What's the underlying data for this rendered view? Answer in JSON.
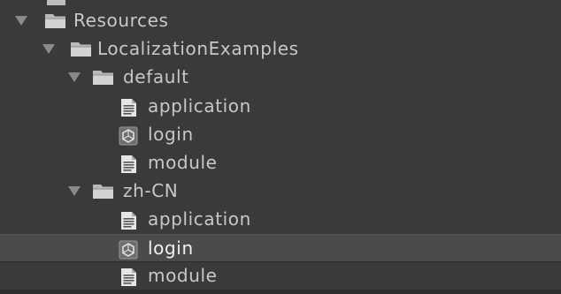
{
  "tree": {
    "items": [
      {
        "label": "Resources",
        "depth": 0,
        "type": "folder",
        "expanded": true,
        "icon": "folder-icon"
      },
      {
        "label": "LocalizationExamples",
        "depth": 1,
        "type": "folder",
        "expanded": true,
        "icon": "folder-icon"
      },
      {
        "label": "default",
        "depth": 2,
        "type": "folder",
        "expanded": true,
        "icon": "folder-icon"
      },
      {
        "label": "application",
        "depth": 3,
        "type": "file",
        "icon": "text-file-icon"
      },
      {
        "label": "login",
        "depth": 3,
        "type": "asset",
        "icon": "unity-asset-icon"
      },
      {
        "label": "module",
        "depth": 3,
        "type": "file",
        "icon": "text-file-icon"
      },
      {
        "label": "zh-CN",
        "depth": 2,
        "type": "folder",
        "expanded": true,
        "icon": "folder-icon"
      },
      {
        "label": "application",
        "depth": 3,
        "type": "file",
        "icon": "text-file-icon"
      },
      {
        "label": "login",
        "depth": 3,
        "type": "asset",
        "icon": "unity-asset-icon",
        "selected": true
      },
      {
        "label": "module",
        "depth": 3,
        "type": "file",
        "icon": "text-file-icon"
      }
    ]
  },
  "colors": {
    "background": "#3a3a3a",
    "selected_row": "#4b4b4b",
    "text": "#c8c8c8",
    "selected_text": "#f0f0f0",
    "arrow": "#8a8a8a",
    "folder": "#c8c8c8"
  }
}
